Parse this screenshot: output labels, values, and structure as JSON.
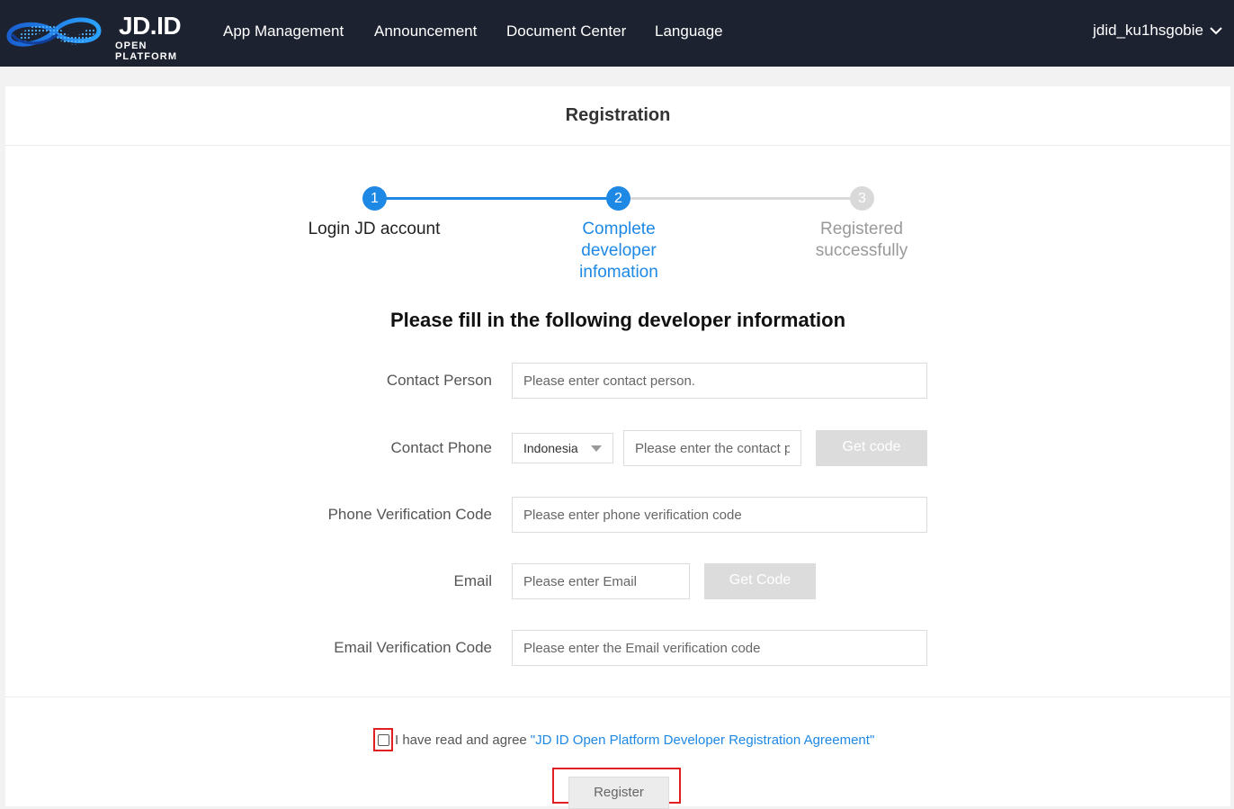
{
  "header": {
    "logo_title": "JD.ID",
    "logo_subtitle": "OPEN PLATFORM",
    "nav": [
      {
        "label": "App Management"
      },
      {
        "label": "Announcement"
      },
      {
        "label": "Document Center"
      },
      {
        "label": "Language"
      }
    ],
    "username": "jdid_ku1hsgobie"
  },
  "page": {
    "title": "Registration",
    "steps": [
      {
        "number": "1",
        "label": "Login JD account",
        "state": "done"
      },
      {
        "number": "2",
        "label": "Complete developer infomation",
        "state": "active"
      },
      {
        "number": "3",
        "label": "Registered successfully",
        "state": "pending"
      }
    ],
    "form_heading": "Please fill in the following developer information"
  },
  "form": {
    "contact_person": {
      "label": "Contact Person",
      "placeholder": "Please enter contact person."
    },
    "contact_phone": {
      "label": "Contact Phone",
      "country": "Indonesia",
      "placeholder": "Please enter the contact phone",
      "button": "Get code"
    },
    "phone_code": {
      "label": "Phone Verification Code",
      "placeholder": "Please enter phone verification code"
    },
    "email": {
      "label": "Email",
      "placeholder": "Please enter Email",
      "button": "Get Code"
    },
    "email_code": {
      "label": "Email Verification Code",
      "placeholder": "Please enter the Email verification code"
    }
  },
  "agreement": {
    "text": "I have read and agree",
    "link": "\"JD ID Open Platform Developer Registration Agreement\"",
    "checked": false
  },
  "register_button": "Register",
  "colors": {
    "header_bg": "#1d2230",
    "accent": "#1e88e5",
    "step_inactive": "#d0d0d0",
    "highlight_border": "#e02020"
  }
}
